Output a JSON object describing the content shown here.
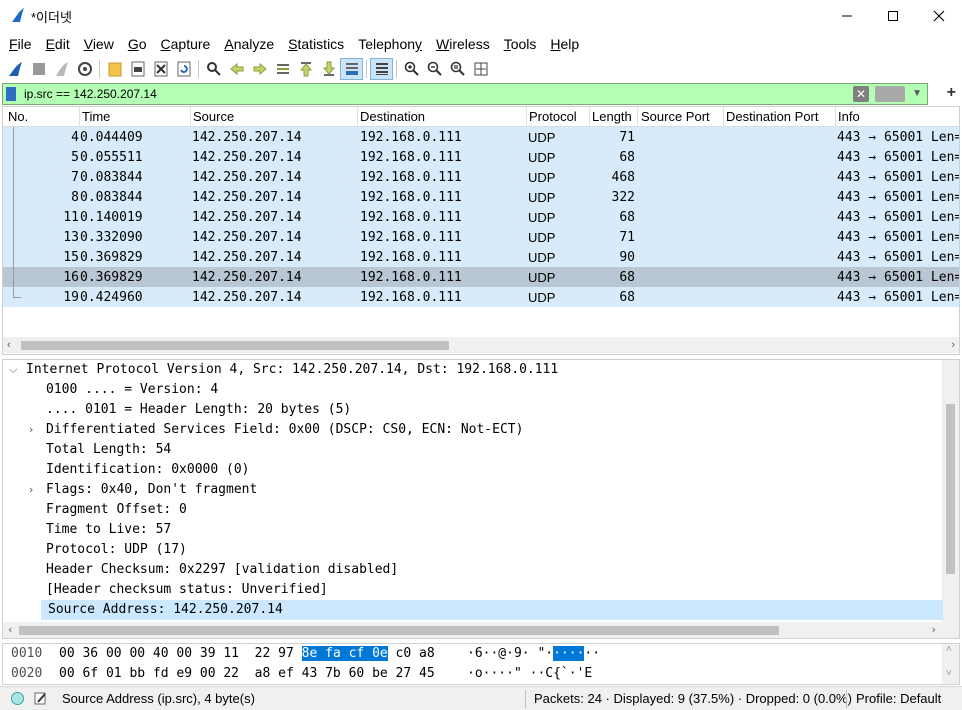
{
  "window": {
    "title": "*이더넷"
  },
  "menu": [
    "File",
    "Edit",
    "View",
    "Go",
    "Capture",
    "Analyze",
    "Statistics",
    "Telephony",
    "Wireless",
    "Tools",
    "Help"
  ],
  "menu_underline": [
    "F",
    "E",
    "V",
    "G",
    "C",
    "A",
    "S",
    "y",
    "W",
    "T",
    "H"
  ],
  "filter": {
    "value": "ip.src == 142.250.207.14"
  },
  "columns": [
    "No.",
    "Time",
    "Source",
    "Destination",
    "Protocol",
    "Length",
    "Source Port",
    "Destination Port",
    "Info"
  ],
  "packets": [
    {
      "no": "4",
      "time": "0.044409",
      "src": "142.250.207.14",
      "dst": "192.168.0.111",
      "proto": "UDP",
      "len": "71",
      "info": "443 → 65001 Len="
    },
    {
      "no": "5",
      "time": "0.055511",
      "src": "142.250.207.14",
      "dst": "192.168.0.111",
      "proto": "UDP",
      "len": "68",
      "info": "443 → 65001 Len="
    },
    {
      "no": "7",
      "time": "0.083844",
      "src": "142.250.207.14",
      "dst": "192.168.0.111",
      "proto": "UDP",
      "len": "468",
      "info": "443 → 65001 Len="
    },
    {
      "no": "8",
      "time": "0.083844",
      "src": "142.250.207.14",
      "dst": "192.168.0.111",
      "proto": "UDP",
      "len": "322",
      "info": "443 → 65001 Len="
    },
    {
      "no": "11",
      "time": "0.140019",
      "src": "142.250.207.14",
      "dst": "192.168.0.111",
      "proto": "UDP",
      "len": "68",
      "info": "443 → 65001 Len="
    },
    {
      "no": "13",
      "time": "0.332090",
      "src": "142.250.207.14",
      "dst": "192.168.0.111",
      "proto": "UDP",
      "len": "71",
      "info": "443 → 65001 Len="
    },
    {
      "no": "15",
      "time": "0.369829",
      "src": "142.250.207.14",
      "dst": "192.168.0.111",
      "proto": "UDP",
      "len": "90",
      "info": "443 → 65001 Len="
    },
    {
      "no": "16",
      "time": "0.369829",
      "src": "142.250.207.14",
      "dst": "192.168.0.111",
      "proto": "UDP",
      "len": "68",
      "info": "443 → 65001 Len="
    },
    {
      "no": "19",
      "time": "0.424960",
      "src": "142.250.207.14",
      "dst": "192.168.0.111",
      "proto": "UDP",
      "len": "68",
      "info": "443 → 65001 Len="
    }
  ],
  "selected_packet_index": 7,
  "details": [
    {
      "text": "Internet Protocol Version 4, Src: 142.250.207.14, Dst: 192.168.0.111",
      "indent": 0,
      "toggle": "expanded"
    },
    {
      "text": "0100 .... = Version: 4",
      "indent": 1,
      "toggle": ""
    },
    {
      "text": ".... 0101 = Header Length: 20 bytes (5)",
      "indent": 1,
      "toggle": ""
    },
    {
      "text": "Differentiated Services Field: 0x00 (DSCP: CS0, ECN: Not-ECT)",
      "indent": 1,
      "toggle": "collapsed"
    },
    {
      "text": "Total Length: 54",
      "indent": 1,
      "toggle": ""
    },
    {
      "text": "Identification: 0x0000 (0)",
      "indent": 1,
      "toggle": ""
    },
    {
      "text": "Flags: 0x40, Don't fragment",
      "indent": 1,
      "toggle": "collapsed"
    },
    {
      "text": "Fragment Offset: 0",
      "indent": 1,
      "toggle": ""
    },
    {
      "text": "Time to Live: 57",
      "indent": 1,
      "toggle": ""
    },
    {
      "text": "Protocol: UDP (17)",
      "indent": 1,
      "toggle": ""
    },
    {
      "text": "Header Checksum: 0x2297 [validation disabled]",
      "indent": 1,
      "toggle": ""
    },
    {
      "text": "[Header checksum status: Unverified]",
      "indent": 1,
      "toggle": ""
    },
    {
      "text": "Source Address: 142.250.207.14",
      "indent": 1,
      "toggle": "",
      "selected": true
    }
  ],
  "bytes": [
    {
      "offset": "0010",
      "hex_before": "00 36 00 00 40 00 39 11  22 97 ",
      "hex_sel": "8e fa cf 0e",
      "hex_after": " c0 a8",
      "ascii_before": "·6··@·9· \"·",
      "ascii_sel": "····",
      "ascii_after": "··"
    },
    {
      "offset": "0020",
      "hex_before": "00 6f 01 bb fd e9 00 22  a8 ef 43 7b 60 be 27 45",
      "hex_sel": "",
      "hex_after": "",
      "ascii_before": "·o····\" ··C{`·'E",
      "ascii_sel": "",
      "ascii_after": ""
    }
  ],
  "status": {
    "field": "Source Address (ip.src), 4 byte(s)",
    "packets": "Packets: 24 · Displayed: 9 (37.5%) · Dropped: 0 (0.0%)",
    "profile": "Profile: Default"
  },
  "colors": {
    "row_bg": "#d7ebfa",
    "row_selected_bg": "#b9c6d3",
    "filter_ok_bg": "#b3ffb3",
    "detail_selected_bg": "#cce8ff",
    "byte_highlight": "#0078d7"
  }
}
